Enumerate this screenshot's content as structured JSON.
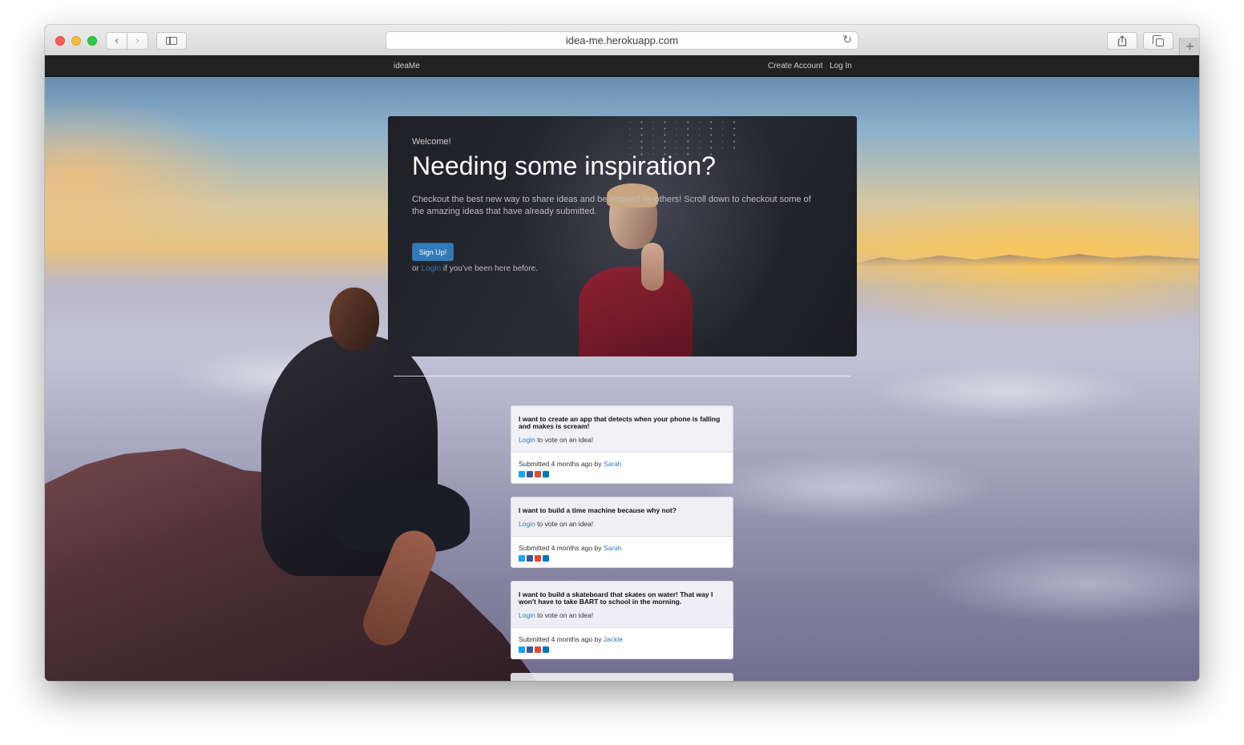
{
  "browser": {
    "url": "idea-me.herokuapp.com",
    "icons": [
      "back-icon",
      "forward-icon",
      "sidebar-icon",
      "reload-icon",
      "share-icon",
      "tabs-icon",
      "new-tab-icon"
    ]
  },
  "nav": {
    "brand": "ideaMe",
    "links": [
      "Create Account",
      "Log In"
    ]
  },
  "hero": {
    "welcome": "Welcome!",
    "headline": "Needing some inspiration?",
    "lead": "Checkout the best new way to share ideas and be inspired by others! Scroll down to checkout some of the amazing ideas that have already submitted.",
    "signup_label": "Sign Up!",
    "login_prefix": "or ",
    "login_link": "Login",
    "login_suffix": " if you've been here before."
  },
  "ideas": [
    {
      "title": "I want to create an app that detects when your phone is falling and makes is scream!",
      "vote_link": "Login",
      "vote_text": " to vote on an idea!",
      "meta_prefix": "Submitted 4 months ago by ",
      "author": "Sarah"
    },
    {
      "title": "I want to build a time machine because why not?",
      "vote_link": "Login",
      "vote_text": " to vote on an idea!",
      "meta_prefix": "Submitted 4 months ago by ",
      "author": "Sarah"
    },
    {
      "title": "I want to build a skateboard that skates on water! That way I won't have to take BART to school in the morning.",
      "vote_link": "Login",
      "vote_text": " to vote on an idea!",
      "meta_prefix": "Submitted 4 months ago by ",
      "author": "Jackie"
    }
  ],
  "colors": {
    "link": "#337ab7",
    "navbar": "#222222",
    "signup_button": "#337ab7"
  }
}
